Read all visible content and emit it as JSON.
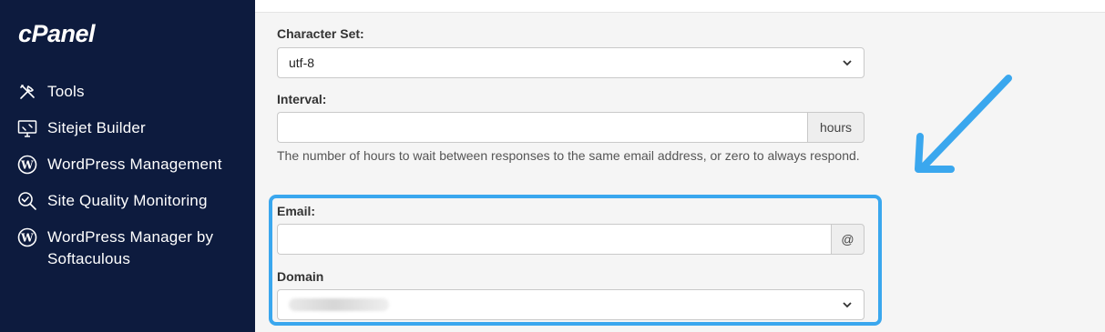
{
  "sidebar": {
    "logo": "cPanel",
    "items": [
      {
        "label": "Tools",
        "icon": "tools-icon"
      },
      {
        "label": "Sitejet Builder",
        "icon": "monitor-icon"
      },
      {
        "label": "WordPress Management",
        "icon": "wordpress-icon"
      },
      {
        "label": "Site Quality Monitoring",
        "icon": "magnifier-check-icon"
      },
      {
        "label": "WordPress Manager by Softaculous",
        "icon": "wordpress-icon"
      }
    ]
  },
  "form": {
    "charset": {
      "label": "Character Set:",
      "value": "utf-8"
    },
    "interval": {
      "label": "Interval:",
      "value": "",
      "addon": "hours",
      "help": "The number of hours to wait between responses to the same email address, or zero to always respond."
    },
    "email": {
      "label": "Email:",
      "value": "",
      "addon": "@"
    },
    "domain": {
      "label": "Domain",
      "value": ""
    }
  },
  "colors": {
    "sidebar_bg": "#0d1b3e",
    "highlight": "#3aa7ee"
  }
}
